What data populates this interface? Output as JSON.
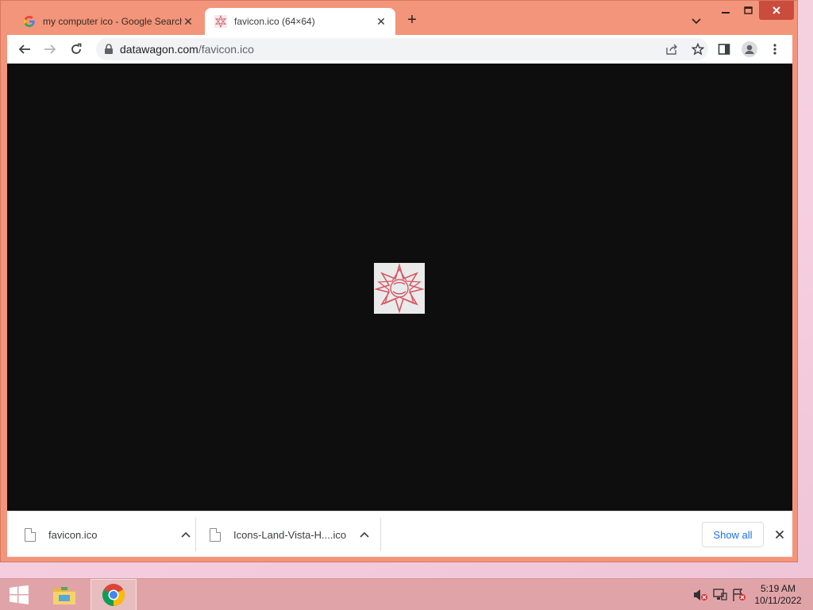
{
  "tabs": [
    {
      "title": "my computer ico - Google Search",
      "icon": "google-g-icon",
      "active": false
    },
    {
      "title": "favicon.ico (64×64)",
      "icon": "favicon-star-icon",
      "active": true
    }
  ],
  "toolbar": {
    "url_host": "datawagon.com",
    "url_path": "/favicon.ico"
  },
  "content": {
    "image_name": "favicon.ico",
    "image_size": "64×64",
    "background": "#0e0e0e"
  },
  "downloads": {
    "items": [
      {
        "name": "favicon.ico"
      },
      {
        "name": "Icons-Land-Vista-H....ico"
      }
    ],
    "show_all_label": "Show all"
  },
  "taskbar": {
    "time": "5:19 AM",
    "date": "10/11/2022"
  },
  "colors": {
    "window_frame": "#f2957a",
    "taskbar": "#e0a4a8",
    "close_button": "#c94c3d",
    "link_blue": "#1a73e8"
  }
}
